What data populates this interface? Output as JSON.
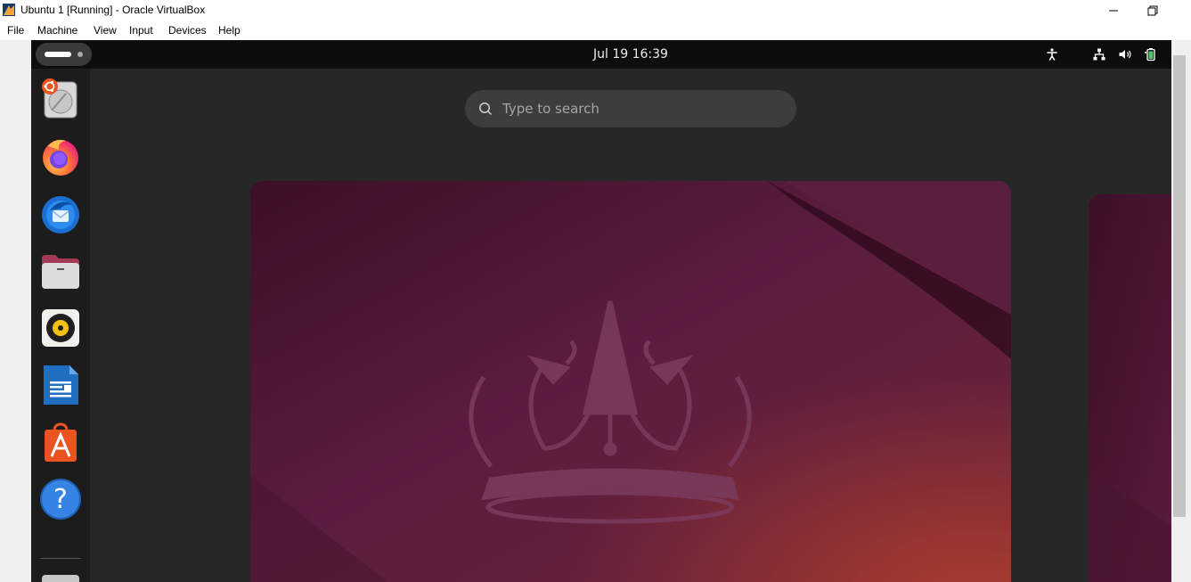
{
  "window": {
    "title": "Ubuntu 1 [Running] - Oracle VirtualBox",
    "controls": [
      "minimize-icon",
      "restore-icon"
    ]
  },
  "menubar": {
    "items": [
      "File",
      "Machine",
      "View",
      "Input",
      "Devices",
      "Help"
    ]
  },
  "gnome_topbar": {
    "activities_icon": "activities-indicator-icon",
    "clock": "Jul 19  16:39",
    "status_icons": [
      "accessibility-icon",
      "network-icon",
      "volume-icon",
      "battery-icon"
    ]
  },
  "dock": {
    "apps": [
      "ubuntu-installer-icon",
      "firefox-icon",
      "thunderbird-icon",
      "files-icon",
      "rhythmbox-icon",
      "libreoffice-writer-icon",
      "app-center-icon",
      "help-icon",
      "drive-icon"
    ]
  },
  "search": {
    "placeholder": "Type to search"
  },
  "colors": {
    "accent": "#e95420",
    "wallpaper": "#5a1f3c",
    "topbar": "#0d0d0d",
    "overview_bg": "#272727"
  }
}
